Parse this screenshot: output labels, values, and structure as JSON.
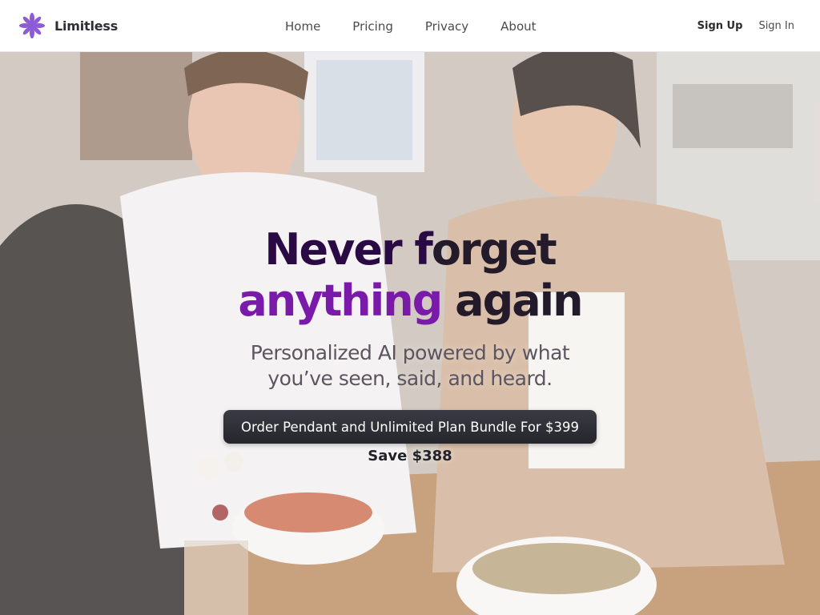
{
  "nav": {
    "brand": "Limitless",
    "links": [
      "Home",
      "Pricing",
      "Privacy",
      "About"
    ],
    "sign_up": "Sign Up",
    "sign_in": "Sign In"
  },
  "hero": {
    "headline": {
      "line1_part1": "Never f",
      "line1_part2": "orget",
      "line2_part1": "anything",
      "line2_part2": " again"
    },
    "subhead": {
      "line1": "Personalized AI powered by what",
      "line2": "you’ve seen, said, and heard."
    },
    "cta_label": "Order Pendant and Unlimited Plan Bundle For $399",
    "save_label": "Save $388"
  },
  "colors": {
    "brand_purple": "#8e5bd6",
    "headline_dark": "#2a0a45",
    "headline_purple": "#7a1aa8",
    "cta_bg": "#2e2e36"
  },
  "icons": {
    "logo": "asterisk-flower-logo-icon"
  }
}
